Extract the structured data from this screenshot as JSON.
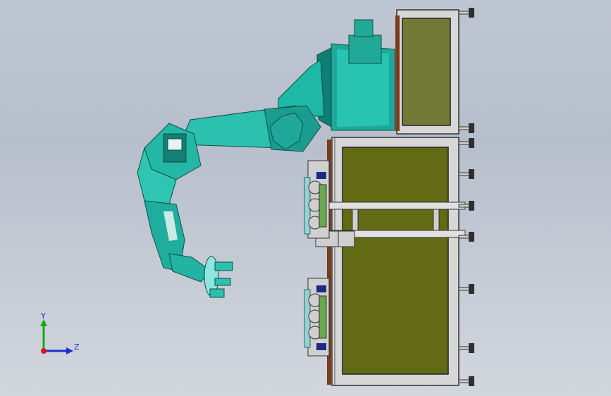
{
  "triad": {
    "y_label": "Y",
    "z_label": "Z"
  }
}
